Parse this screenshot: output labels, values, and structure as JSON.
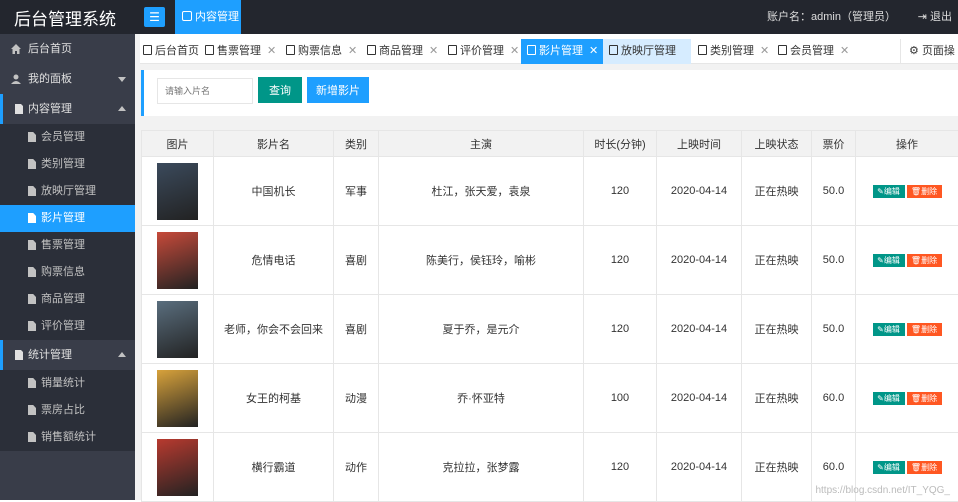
{
  "app": {
    "title": "后台管理系统",
    "menu_icon": "hamburger-icon"
  },
  "top_tab": {
    "label": "内容管理"
  },
  "account": {
    "text": "账户名：admin（管理员）",
    "logout_label": "退出"
  },
  "sidebar": {
    "home": "后台首页",
    "my_panel": "我的面板",
    "content": {
      "label": "内容管理",
      "items": [
        "会员管理",
        "类别管理",
        "放映厅管理",
        "影片管理",
        "售票管理",
        "购票信息",
        "商品管理",
        "评价管理"
      ],
      "active": "影片管理"
    },
    "stats": {
      "label": "统计管理",
      "items": [
        "销量统计",
        "票房占比",
        "销售额统计"
      ]
    }
  },
  "page_tabs": [
    {
      "label": "后台首页",
      "closable": false
    },
    {
      "label": "售票管理",
      "closable": true
    },
    {
      "label": "购票信息",
      "closable": true
    },
    {
      "label": "商品管理",
      "closable": true
    },
    {
      "label": "评价管理",
      "closable": true
    },
    {
      "label": "影片管理",
      "closable": true
    },
    {
      "label": "放映厅管理",
      "closable": true
    },
    {
      "label": "类别管理",
      "closable": true
    },
    {
      "label": "会员管理",
      "closable": true
    }
  ],
  "page_ops_label": "页面操作",
  "search": {
    "placeholder": "请输入片名",
    "query_label": "查询",
    "add_label": "新增影片"
  },
  "table": {
    "headers": [
      "图片",
      "影片名",
      "类别",
      "主演",
      "时长(分钟)",
      "上映时间",
      "上映状态",
      "票价",
      "操作"
    ],
    "rows": [
      {
        "name": "中国机长",
        "category": "军事",
        "actors": "杜江，张天爱，袁泉",
        "duration": "120",
        "date": "2020-04-14",
        "status": "正在热映",
        "price": "50.0",
        "poster_color": "#3b4a5c"
      },
      {
        "name": "危情电话",
        "category": "喜剧",
        "actors": "陈美行，侯钰玲，喻彬",
        "duration": "120",
        "date": "2020-04-14",
        "status": "正在热映",
        "price": "50.0",
        "poster_color": "#c74a3a"
      },
      {
        "name": "老师，你会不会回来",
        "category": "喜剧",
        "actors": "夏于乔，是元介",
        "duration": "120",
        "date": "2020-04-14",
        "status": "正在热映",
        "price": "50.0",
        "poster_color": "#5a6e7e"
      },
      {
        "name": "女王的柯基",
        "category": "动漫",
        "actors": "乔·怀亚特",
        "duration": "100",
        "date": "2020-04-14",
        "status": "正在热映",
        "price": "60.0",
        "poster_color": "#d8a23b"
      },
      {
        "name": "横行霸道",
        "category": "动作",
        "actors": "克拉拉，张梦露",
        "duration": "120",
        "date": "2020-04-14",
        "status": "正在热映",
        "price": "60.0",
        "poster_color": "#b83a2f"
      }
    ],
    "edit_label": "编辑",
    "delete_label": "删除"
  },
  "watermark": "https://blog.csdn.net/IT_YQG_"
}
